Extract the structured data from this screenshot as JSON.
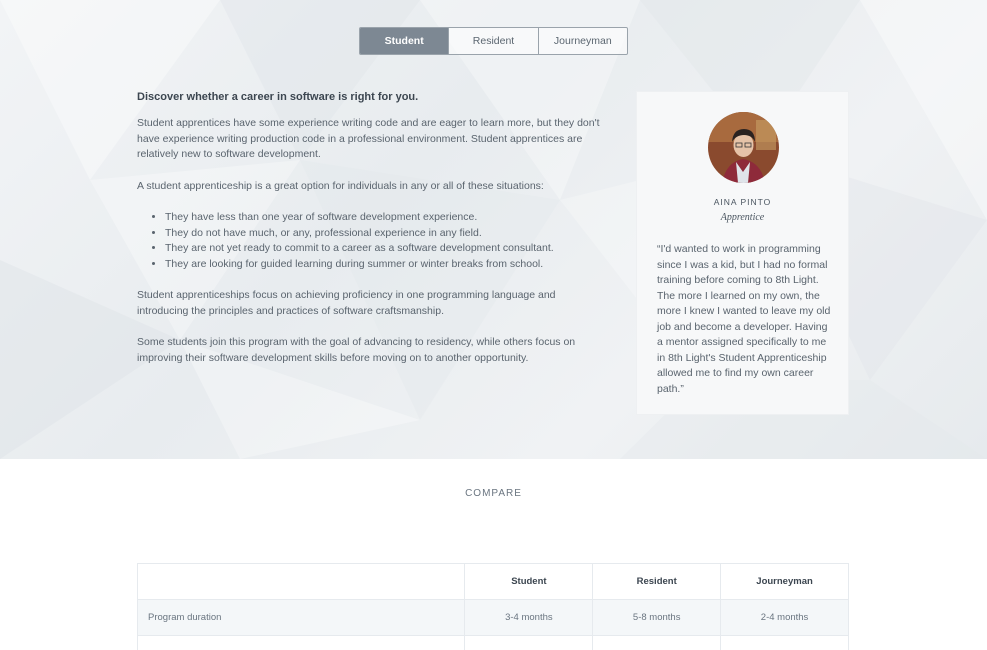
{
  "tabs": [
    {
      "label": "Student",
      "active": true
    },
    {
      "label": "Resident",
      "active": false
    },
    {
      "label": "Journeyman",
      "active": false
    }
  ],
  "main": {
    "lead": "Discover whether a career in software is right for you.",
    "p1": "Student apprentices have some experience writing code and are eager to learn more, but they don't have experience writing production code in a professional environment. Student apprentices are relatively new to software development.",
    "p2": "A student apprenticeship is a great option for individuals in any or all of these situations:",
    "bullets": [
      "They have less than one year of software development experience.",
      "They do not have much, or any, professional experience in any field.",
      "They are not yet ready to commit to a career as a software development consultant.",
      "They are looking for guided learning during summer or winter breaks from school."
    ],
    "p3": "Student apprenticeships focus on achieving proficiency in one programming language and introducing the principles and practices of software craftsmanship.",
    "p4": "Some students join this program with the goal of advancing to residency, while others focus on improving their software development skills before moving on to another opportunity."
  },
  "testimonial": {
    "name": "AINA PINTO",
    "role": "Apprentice",
    "quote": "“I'd wanted to work in programming since I was a kid, but I had no formal training before coming to 8th Light. The more I learned on my own, the more I knew I wanted to leave my old job and become a developer. Having a mentor assigned specifically to me in 8th Light's Student Apprenticeship allowed me to find my own career path.”"
  },
  "compare": {
    "title": "COMPARE",
    "headers": [
      "",
      "Student",
      "Resident",
      "Journeyman"
    ],
    "rows": [
      {
        "label": "Program duration",
        "values": [
          "3-4 months",
          "5-8 months",
          "2-4 months"
        ]
      }
    ]
  },
  "colors": {
    "active_tab": "#7d8893",
    "text": "#5a646e",
    "heading": "#3c4650"
  }
}
